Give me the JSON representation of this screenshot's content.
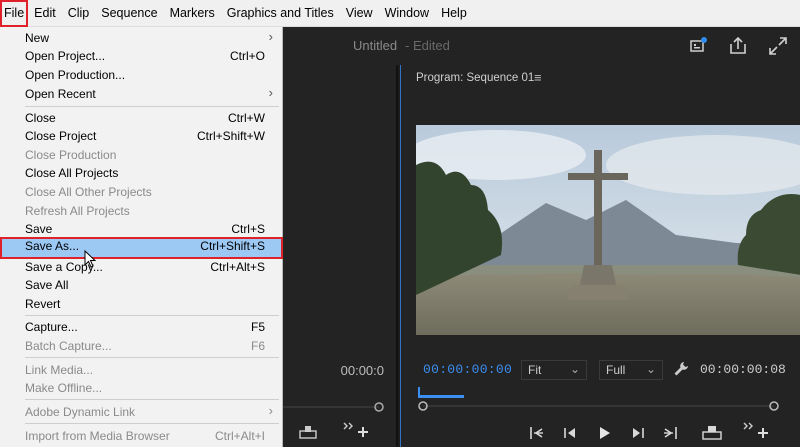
{
  "menubar": {
    "items": [
      "File",
      "Edit",
      "Clip",
      "Sequence",
      "Markers",
      "Graphics and Titles",
      "View",
      "Window",
      "Help"
    ]
  },
  "header": {
    "title": "Untitled",
    "state": "- Edited"
  },
  "left_panel": {
    "timecode": "00:00:0"
  },
  "monitor": {
    "title": "Program: Sequence 01",
    "menu_glyph": "≡",
    "current_timecode": "00:00:00:00",
    "fit_value": "Fit",
    "resolution_value": "Full",
    "duration_timecode": "00:00:00:08"
  },
  "file_menu": {
    "items": [
      {
        "label": "New",
        "shortcut": "",
        "submenu": true,
        "disabled": false
      },
      {
        "label": "Open Project...",
        "shortcut": "Ctrl+O",
        "disabled": false
      },
      {
        "label": "Open Production...",
        "shortcut": "",
        "disabled": false
      },
      {
        "label": "Open Recent",
        "shortcut": "",
        "submenu": true,
        "disabled": false
      },
      {
        "label": "Close",
        "shortcut": "Ctrl+W",
        "disabled": false
      },
      {
        "label": "Close Project",
        "shortcut": "Ctrl+Shift+W",
        "disabled": false
      },
      {
        "label": "Close Production",
        "shortcut": "",
        "disabled": true
      },
      {
        "label": "Close All Projects",
        "shortcut": "",
        "disabled": false
      },
      {
        "label": "Close All Other Projects",
        "shortcut": "",
        "disabled": true
      },
      {
        "label": "Refresh All Projects",
        "shortcut": "",
        "disabled": true
      },
      {
        "label": "Save",
        "shortcut": "Ctrl+S",
        "disabled": false
      },
      {
        "label": "Save As...",
        "shortcut": "Ctrl+Shift+S",
        "disabled": false,
        "highlighted": true
      },
      {
        "label": "Save a Copy...",
        "shortcut": "Ctrl+Alt+S",
        "disabled": false
      },
      {
        "label": "Save All",
        "shortcut": "",
        "disabled": false
      },
      {
        "label": "Revert",
        "shortcut": "",
        "disabled": false
      },
      {
        "label": "Capture...",
        "shortcut": "F5",
        "disabled": false
      },
      {
        "label": "Batch Capture...",
        "shortcut": "F6",
        "disabled": true
      },
      {
        "label": "Link Media...",
        "shortcut": "",
        "disabled": true
      },
      {
        "label": "Make Offline...",
        "shortcut": "",
        "disabled": true
      },
      {
        "label": "Adobe Dynamic Link",
        "shortcut": "",
        "submenu": true,
        "disabled": true
      },
      {
        "label": "Import from Media Browser",
        "shortcut": "Ctrl+Alt+I",
        "disabled": true
      }
    ],
    "submenu_glyph": "›"
  },
  "colors": {
    "accent_blue": "#3a8ff0",
    "highlight": "#9cc8f4",
    "annotation_red": "#e0202a"
  }
}
